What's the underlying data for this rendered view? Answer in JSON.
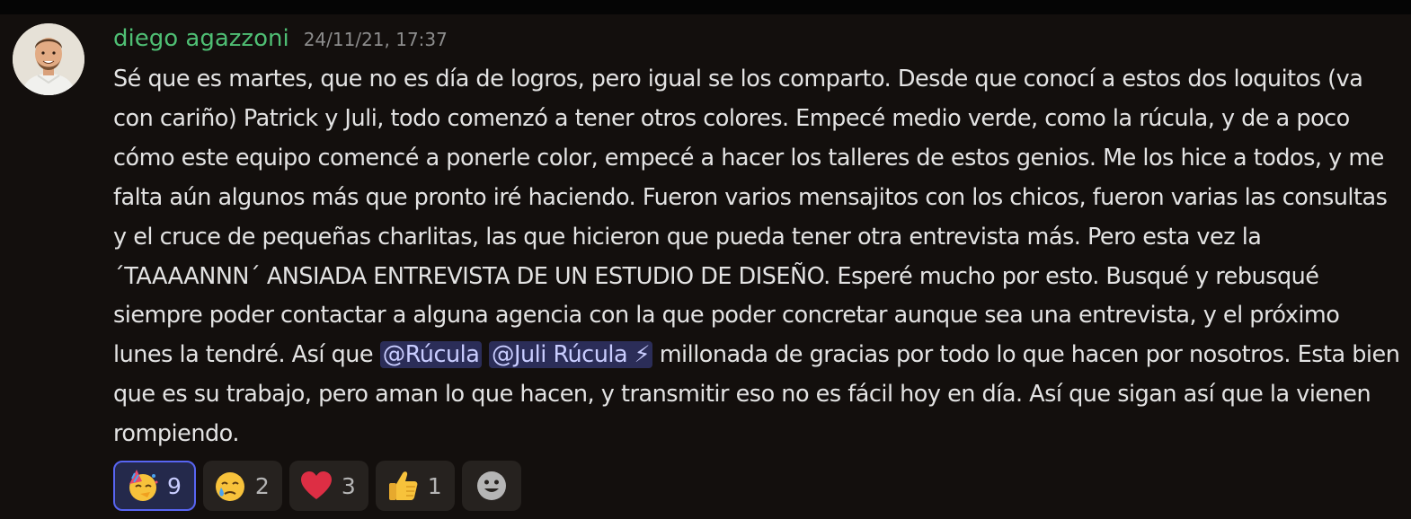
{
  "message": {
    "author": "diego agazzoni",
    "timestamp": "24/11/21, 17:37",
    "text_before": "Sé que es martes, que no es día de logros, pero igual se los comparto. Desde que conocí a estos dos loquitos (va con cariño) Patrick y Juli, todo comenzó a tener otros colores. Empecé medio verde, como la rúcula, y de a poco cómo este equipo comencé a ponerle color, empecé a hacer los talleres de estos genios. Me los hice a todos, y me falta aún algunos más que pronto iré haciendo. Fueron varios mensajitos con los chicos, fueron varias las consultas y el cruce de pequeñas charlitas, las que hicieron que pueda tener otra entrevista más. Pero esta vez la ´TAAAANNN´ ANSIADA ENTREVISTA DE UN ESTUDIO DE DISEÑO. Esperé mucho por esto. Busqué y rebusqué siempre poder contactar a alguna agencia con la que poder concretar aunque sea una entrevista, y el próximo lunes la tendré. Así que ",
    "mention_1": "@Rúcula",
    "mention_2": "@Juli Rúcula ⚡",
    "text_after": " millonada de gracias por todo lo que hacen por nosotros. Esta bien que es su trabajo, pero aman lo que hacen, y transmitir eso no es fácil hoy en día. Así que sigan así que la vienen rompiendo."
  },
  "reactions": [
    {
      "icon": "party-face-icon",
      "count": "9",
      "selected": true
    },
    {
      "icon": "crying-face-icon",
      "count": "2",
      "selected": false
    },
    {
      "icon": "red-heart-icon",
      "count": "3",
      "selected": false
    },
    {
      "icon": "thumbs-up-icon",
      "count": "1",
      "selected": false
    }
  ],
  "colors": {
    "background": "#130f0d",
    "username": "#4fbf74",
    "mention_bg": "#2b2d58",
    "mention_text": "#c9cdff",
    "selected_border": "#5865f2"
  }
}
